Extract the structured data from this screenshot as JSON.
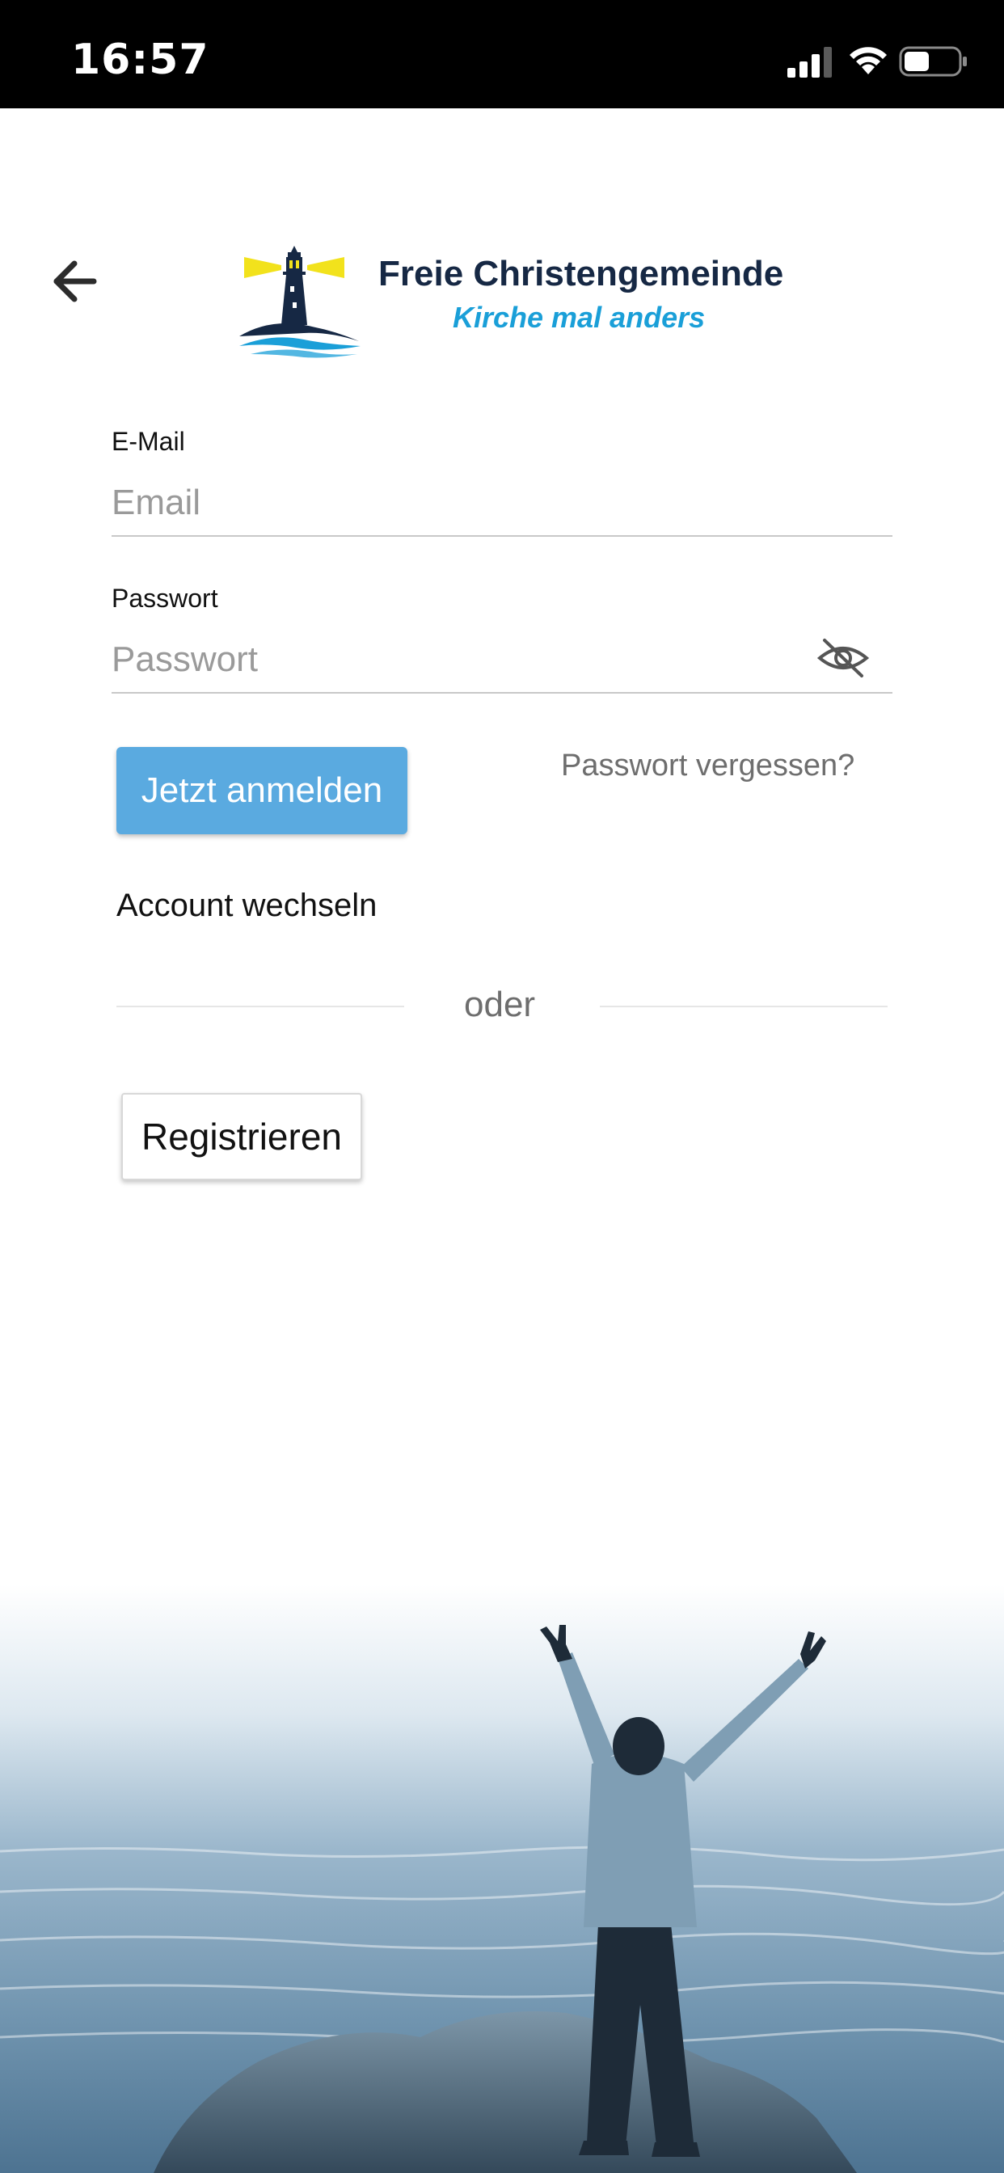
{
  "status_bar": {
    "time": "16:57",
    "icons": [
      "signal-icon",
      "wifi-icon",
      "battery-icon"
    ]
  },
  "header": {
    "back_icon": "back-arrow-icon",
    "logo_icon": "lighthouse-logo",
    "brand_name": "Freie Christengemeinde",
    "tagline": "Kirche mal anders"
  },
  "form": {
    "email": {
      "label": "E-Mail",
      "placeholder": "Email",
      "value": ""
    },
    "password": {
      "label": "Passwort",
      "placeholder": "Passwort",
      "value": "",
      "toggle_icon": "eye-slash-icon"
    },
    "login_label": "Jetzt anmelden",
    "forgot_label": "Passwort vergessen?",
    "switch_account_label": "Account wechseln",
    "divider_label": "oder",
    "register_label": "Registrieren"
  },
  "background": {
    "image": "person-arms-raised-at-sea",
    "tint": "#5c86a6"
  },
  "colors": {
    "primary": "#5aaae0",
    "brand_dark": "#162844",
    "brand_accent": "#1a9fd8",
    "lighthouse_beam": "#f2e21c"
  }
}
